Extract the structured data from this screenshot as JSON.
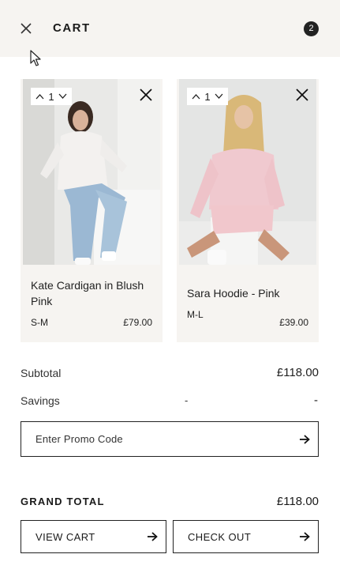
{
  "header": {
    "title": "CART",
    "item_count": "2"
  },
  "items": [
    {
      "name": "Kate Cardigan in Blush Pink",
      "size": "S-M",
      "price": "£79.00",
      "quantity": "1"
    },
    {
      "name": "Sara Hoodie - Pink",
      "size": "M-L",
      "price": "£39.00",
      "quantity": "1"
    }
  ],
  "summary": {
    "subtotal_label": "Subtotal",
    "subtotal_value": "£118.00",
    "savings_label": "Savings",
    "savings_mid": "-",
    "savings_value": "-"
  },
  "promo": {
    "placeholder": "Enter Promo Code"
  },
  "grand_total": {
    "label": "GRAND TOTAL",
    "value": "£118.00"
  },
  "buttons": {
    "view_cart": "VIEW CART",
    "check_out": "CHECK OUT"
  },
  "icons": {
    "close": "close-icon",
    "remove": "close-icon",
    "qty_up": "chevron-up-icon",
    "qty_down": "chevron-down-icon",
    "arrow": "arrow-right-icon"
  },
  "colors": {
    "panel_bg": "#f6f4f1",
    "badge_bg": "#222222",
    "border": "#222222"
  }
}
